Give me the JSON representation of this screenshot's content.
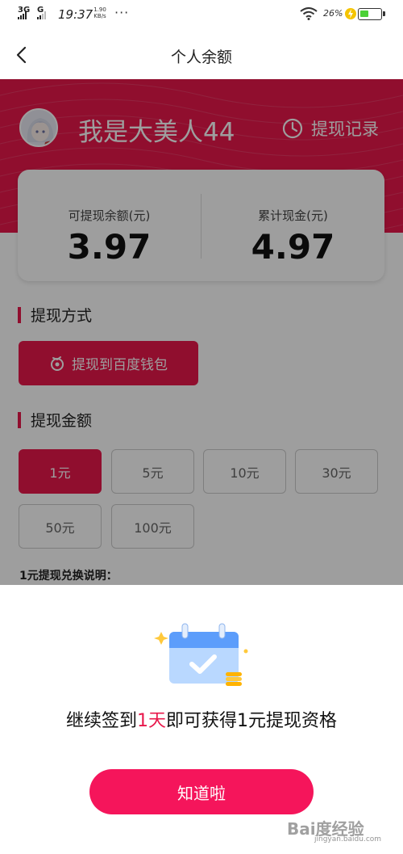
{
  "status_bar": {
    "network1": "3G",
    "network2": "G",
    "time": "19:37",
    "speed_value": "1.90",
    "speed_unit": "KB/s",
    "more": "···",
    "battery_pct": "26%",
    "battery_level": 0.26,
    "battery_color": "#4cd137"
  },
  "header": {
    "back_icon": "chevron-left-icon",
    "title": "个人余额"
  },
  "profile": {
    "username": "我是大美人44",
    "history_label": "提现记录",
    "history_icon": "clock-icon"
  },
  "balance": {
    "withdrawable_label": "可提现余额(元)",
    "withdrawable_value": "3.97",
    "total_label": "累计现金(元)",
    "total_value": "4.97"
  },
  "method": {
    "section_title": "提现方式",
    "button_label": "提现到百度钱包",
    "button_icon": "baidu-wallet-icon"
  },
  "amount": {
    "section_title": "提现金额",
    "options": [
      {
        "label": "1元",
        "selected": true
      },
      {
        "label": "5元",
        "selected": false
      },
      {
        "label": "10元",
        "selected": false
      },
      {
        "label": "30元",
        "selected": false
      },
      {
        "label": "50元",
        "selected": false
      },
      {
        "label": "100元",
        "selected": false
      }
    ],
    "rules_title": "1元提现兑换说明："
  },
  "dialog": {
    "icon": "calendar-check-icon",
    "msg_pre": "继续签到",
    "msg_highlight": "1天",
    "msg_post": "即可获得1元提现资格",
    "confirm_label": "知道啦"
  },
  "colors": {
    "accent": "#e8184b",
    "confirm_button": "#f5155b"
  },
  "watermark": {
    "brand": "Bai度经验",
    "url": "jingyan.baidu.com"
  }
}
